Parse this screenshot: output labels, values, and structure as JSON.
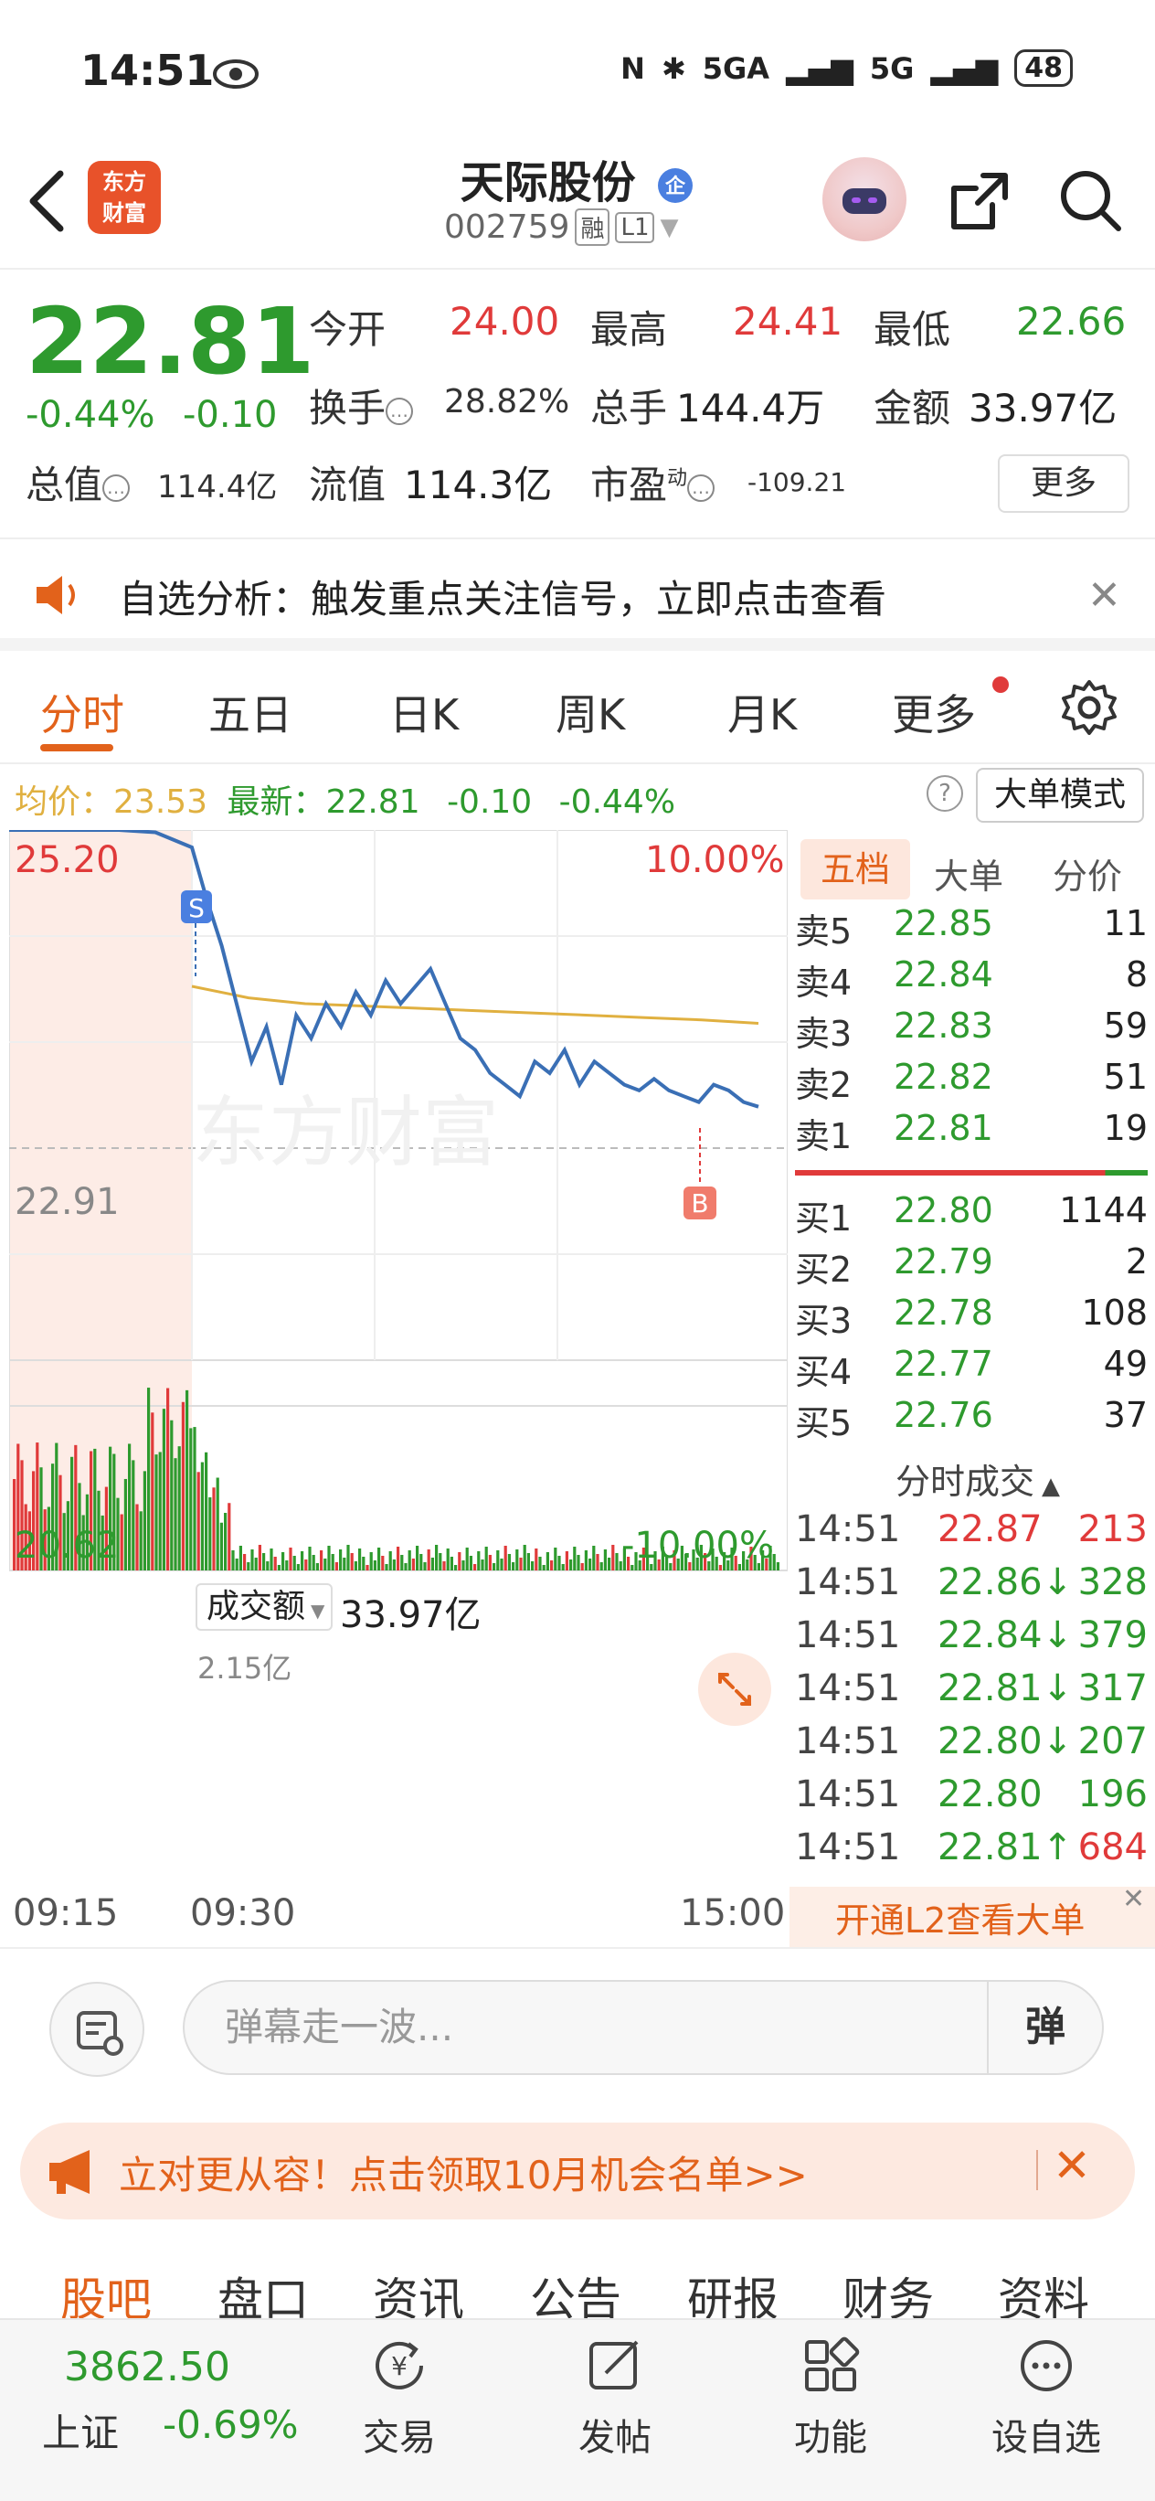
{
  "status_bar": {
    "time": "14:51",
    "network1": "5GA",
    "network2": "5G",
    "battery": "48"
  },
  "header": {
    "brand_logo": "东方\n财富",
    "stock_name": "天际股份",
    "stock_code": "002759",
    "tag_margin": "融",
    "tag_level": "L1"
  },
  "quote": {
    "price": "22.81",
    "change_pct": "-0.44%",
    "change_amt": "-0.10",
    "open_label": "今开",
    "open": "24.00",
    "high_label": "最高",
    "high": "24.41",
    "low_label": "最低",
    "low": "22.66",
    "turnover_label": "换手",
    "turnover": "28.82%",
    "volume_label": "总手",
    "volume": "144.4万",
    "amount_label": "金额",
    "amount": "33.97亿",
    "mktcap_label": "总值",
    "mktcap": "114.4亿",
    "float_label": "流值",
    "float": "114.3亿",
    "pe_label": "市盈",
    "pe_sup": "动",
    "pe": "-109.21",
    "more_label": "更多"
  },
  "notice": {
    "text": "自选分析：触发重点关注信号，立即点击查看"
  },
  "tabs": [
    "分时",
    "五日",
    "日K",
    "周K",
    "月K",
    "更多"
  ],
  "stat_line": {
    "avg_label": "均价：",
    "avg": "23.53",
    "latest_label": "最新：",
    "latest": "22.81",
    "chg": "-0.10",
    "pct": "-0.44%",
    "help": "?",
    "mode_button": "大单模式"
  },
  "chart_data": {
    "type": "line",
    "price_top": "25.20",
    "price_mid": "22.91",
    "price_bottom": "20.62",
    "pct_top": "10.00%",
    "pct_bottom": "-10.00%",
    "ylim": [
      20.62,
      25.2
    ],
    "prev_close": 22.91,
    "sell_marker": "S",
    "buy_marker": "B",
    "price_series": [
      25.2,
      25.2,
      25.2,
      25.2,
      25.18,
      25.05,
      24.6,
      24.2,
      23.7,
      23.2,
      23.5,
      23.0,
      23.6,
      23.4,
      23.7,
      23.5,
      23.8,
      23.6,
      23.9,
      23.7,
      23.85,
      24.0,
      23.7,
      23.4,
      23.3,
      23.1,
      23.0,
      22.9,
      23.2,
      23.1,
      23.3,
      23.0,
      23.2,
      23.1,
      23.0,
      22.95,
      23.05,
      22.95,
      22.9,
      22.85,
      23.0,
      22.95,
      22.85,
      22.81
    ],
    "avg_series": [
      23.85,
      23.75,
      23.7,
      23.68,
      23.66,
      23.64,
      23.62,
      23.6,
      23.58,
      23.56,
      23.53
    ],
    "volume_label": "成交额",
    "volume_total": "33.97亿",
    "volume_max": "2.15亿",
    "x_labels": [
      "09:15",
      "09:30",
      "15:00"
    ]
  },
  "order_book": {
    "tabs": [
      "五档",
      "大单",
      "分价"
    ],
    "asks": [
      {
        "label": "卖5",
        "price": "22.85",
        "qty": "11"
      },
      {
        "label": "卖4",
        "price": "22.84",
        "qty": "8"
      },
      {
        "label": "卖3",
        "price": "22.83",
        "qty": "59"
      },
      {
        "label": "卖2",
        "price": "22.82",
        "qty": "51"
      },
      {
        "label": "卖1",
        "price": "22.81",
        "qty": "19"
      }
    ],
    "bids": [
      {
        "label": "买1",
        "price": "22.80",
        "qty": "1144"
      },
      {
        "label": "买2",
        "price": "22.79",
        "qty": "2"
      },
      {
        "label": "买3",
        "price": "22.78",
        "qty": "108"
      },
      {
        "label": "买4",
        "price": "22.77",
        "qty": "49"
      },
      {
        "label": "买5",
        "price": "22.76",
        "qty": "37"
      }
    ],
    "ticks_title": "分时成交",
    "ticks": [
      {
        "time": "14:51",
        "price": "22.87",
        "dir": "",
        "vol": "213",
        "color": "red"
      },
      {
        "time": "14:51",
        "price": "22.86↓",
        "dir": "down",
        "vol": "328",
        "color": "green"
      },
      {
        "time": "14:51",
        "price": "22.84↓",
        "dir": "down",
        "vol": "379",
        "color": "green"
      },
      {
        "time": "14:51",
        "price": "22.81↓",
        "dir": "down",
        "vol": "317",
        "color": "green"
      },
      {
        "time": "14:51",
        "price": "22.80↓",
        "dir": "down",
        "vol": "207",
        "color": "green"
      },
      {
        "time": "14:51",
        "price": "22.80",
        "dir": "",
        "vol": "196",
        "color": "green"
      },
      {
        "time": "14:51",
        "price": "22.81↑",
        "dir": "up",
        "vol": "684",
        "color": "red"
      }
    ],
    "l2_banner": "开通L2查看大单"
  },
  "danmaku": {
    "placeholder": "弹幕走一波...",
    "send_label": "弹"
  },
  "promo": {
    "text": "立对更从容！点击领取10月机会名单>>"
  },
  "content_tabs": [
    "股吧",
    "盘口",
    "资讯",
    "公告",
    "研报",
    "财务",
    "资料"
  ],
  "bottom_nav": {
    "index_value": "3862.50",
    "index_name": "上证",
    "index_change": "-0.69%",
    "items": [
      "交易",
      "发帖",
      "功能",
      "设自选"
    ]
  },
  "colors": {
    "accent": "#e2621b",
    "up": "#e03a3a",
    "down": "#2e9a2e",
    "line": "#3a6fb5",
    "avg": "#e0b040"
  }
}
